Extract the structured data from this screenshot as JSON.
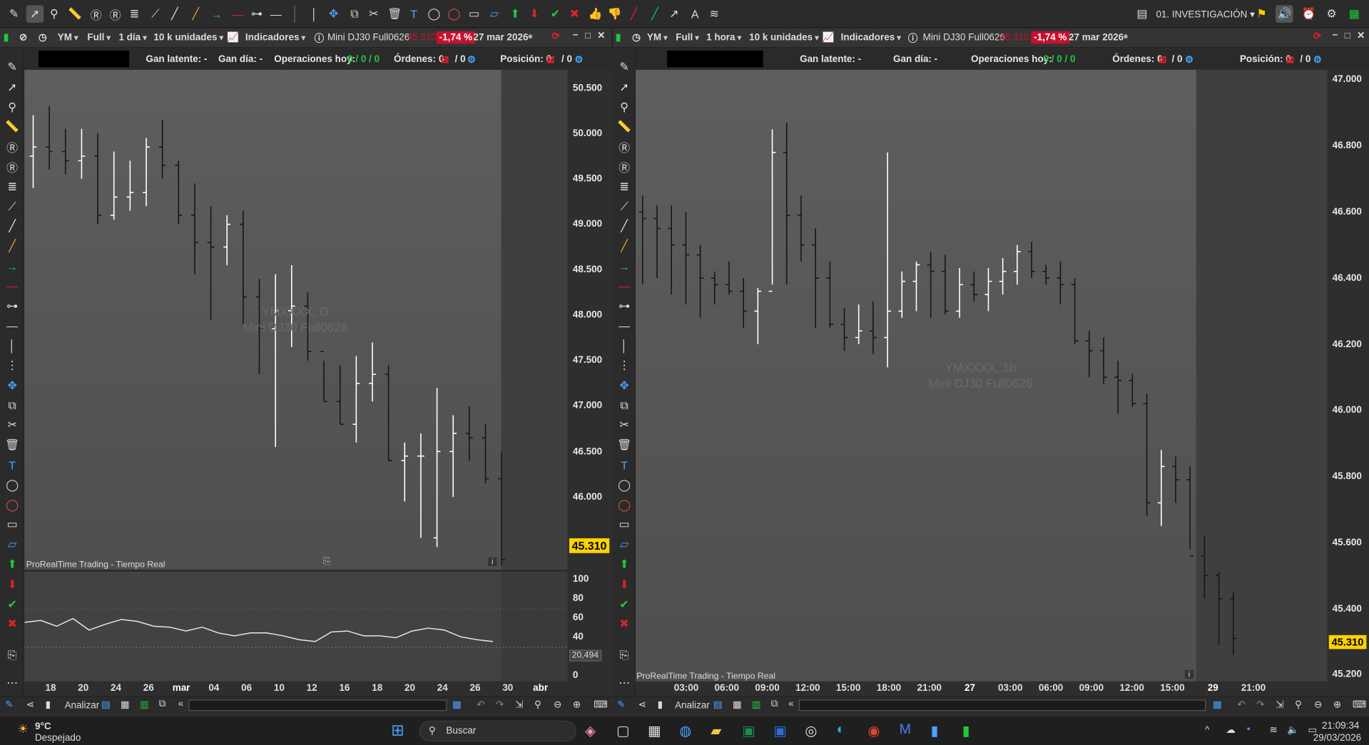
{
  "colors": {
    "up": "#ffffff",
    "down": "#1a1416",
    "neg_badge": "#c8102e",
    "price_tag": "#ffd200",
    "green": "#1ecb3a",
    "red": "#e0202a"
  },
  "toolbar": {
    "icons": [
      "pencil-icon",
      "cursor-icon",
      "zoom-icon",
      "ruler-icon",
      "indicator-r-icon",
      "indicator-r2-icon",
      "fibonacci-icon",
      "segment-icon",
      "line-icon",
      "ray-icon",
      "green-arrow-line-icon",
      "red-line-icon",
      "ray-dots-icon",
      "horizontal-line-icon",
      "vertical-line-icon",
      "move-icon",
      "copy-icon",
      "tools-icon",
      "trash-icon",
      "text-icon",
      "ellipse-icon",
      "red-ellipse-icon",
      "rectangle-icon",
      "parallelogram-icon",
      "up-arrow-icon",
      "down-arrow-icon",
      "check-icon",
      "cross-icon",
      "thumb-up-icon",
      "thumb-down-icon",
      "red-diagonal-icon",
      "green-diagonal-icon",
      "arrow-icon",
      "abc-icon",
      "pattern-icon"
    ],
    "workspace": "01. INVESTIGACIÓN"
  },
  "left_panel": {
    "symbol": "YM",
    "mode": "Full",
    "period": "1 día",
    "units": "10 k unidades",
    "indicators": "Indicadores",
    "instrument": "Mini DJ30 Full0626",
    "price_hidden": "45.310",
    "change": "-1,74 %",
    "date": "27 mar 2026",
    "info": {
      "gan_latente": "Gan latente: -",
      "gan_dia": "Gan día: -",
      "ops_label": "Operaciones hoy:",
      "ops": "0 / 0 / 0",
      "ordenes_label": "Órdenes: 0",
      "ordenes_b": "/ 0",
      "posicion_label": "Posición: 0",
      "posicion_b": "/ 0"
    },
    "watermark": [
      "YMXXXX, D",
      "Mini DJ30 Full0626"
    ],
    "footer": "ProRealTime Trading - Tiempo Real",
    "price_tag": "45.310",
    "rsi_tag": "20,494",
    "yticks": [
      "50.500",
      "50.000",
      "49.500",
      "49.000",
      "48.500",
      "48.000",
      "47.500",
      "47.000",
      "46.500",
      "46.000",
      "45.500"
    ],
    "rsi_ticks": [
      "100",
      "80",
      "60",
      "40",
      "20",
      "0"
    ],
    "xticks": [
      "18",
      "20",
      "24",
      "26",
      "mar",
      "04",
      "06",
      "10",
      "12",
      "16",
      "18",
      "20",
      "24",
      "26",
      "30",
      "abr"
    ]
  },
  "right_panel": {
    "symbol": "YM",
    "mode": "Full",
    "period": "1 hora",
    "units": "10 k unidades",
    "indicators": "Indicadores",
    "instrument": "Mini DJ30 Full0626",
    "price_hidden": "45.310",
    "change": "-1,74 %",
    "date": "27 mar 2026",
    "info": {
      "gan_latente": "Gan latente: -",
      "gan_dia": "Gan día: -",
      "ops_label": "Operaciones hoy:",
      "ops": "0 / 0 / 0",
      "ordenes_label": "Órdenes: 0",
      "ordenes_b": "/ 0",
      "posicion_label": "Posición: 0",
      "posicion_b": "/ 0"
    },
    "watermark": [
      "YMXXXX, 1h",
      "Mini DJ30 Full0626"
    ],
    "footer": "ProRealTime Trading - Tiempo Real",
    "price_tag": "45.310",
    "yticks": [
      "47.000",
      "46.800",
      "46.600",
      "46.400",
      "46.200",
      "46.000",
      "45.800",
      "45.600",
      "45.400",
      "45.200"
    ],
    "xticks": [
      "03:00",
      "06:00",
      "09:00",
      "12:00",
      "15:00",
      "18:00",
      "21:00",
      "27",
      "03:00",
      "06:00",
      "09:00",
      "12:00",
      "15:00",
      "29",
      "21:00"
    ]
  },
  "statusbar": {
    "analyze": "Analizar"
  },
  "taskbar": {
    "temp": "9°C",
    "weather": "Despejado",
    "search": "Buscar",
    "time": "21:09:34",
    "date": "29/03/2026"
  },
  "chart_data": [
    {
      "type": "ohlc",
      "title": "YMXXXX, D",
      "ylim": [
        45200,
        50700
      ],
      "bars": [
        [
          49750,
          50200,
          49400,
          49850
        ],
        [
          49850,
          50300,
          49600,
          49800
        ],
        [
          49800,
          50050,
          49550,
          49700
        ],
        [
          49700,
          50050,
          49500,
          49750
        ],
        [
          49750,
          50000,
          49000,
          49100
        ],
        [
          49100,
          49800,
          49050,
          49300
        ],
        [
          49300,
          49700,
          49150,
          49350
        ],
        [
          49350,
          49950,
          49200,
          49850
        ],
        [
          49850,
          50150,
          49500,
          49650
        ],
        [
          49650,
          49700,
          49000,
          49100
        ],
        [
          49100,
          49450,
          48450,
          48800
        ],
        [
          48800,
          49200,
          47950,
          48750
        ],
        [
          48750,
          49100,
          48550,
          49000
        ],
        [
          49000,
          49150,
          47900,
          48200
        ],
        [
          48200,
          48400,
          47350,
          47850
        ],
        [
          47850,
          48450,
          46550,
          48050
        ],
        [
          48050,
          48550,
          47650,
          48100
        ],
        [
          48100,
          48250,
          47500,
          47600
        ],
        [
          47600,
          47500,
          47050,
          47050
        ],
        [
          47050,
          47450,
          46800,
          46800
        ],
        [
          46800,
          47550,
          46600,
          47250
        ],
        [
          47250,
          47700,
          47050,
          47350
        ],
        [
          47350,
          47450,
          46400,
          46400
        ],
        [
          46400,
          46600,
          45950,
          46450
        ],
        [
          46450,
          46700,
          45550,
          46450
        ],
        [
          45550,
          47200,
          45450,
          46500
        ],
        [
          46500,
          46900,
          46000,
          46700
        ],
        [
          46700,
          47000,
          46400,
          46650
        ],
        [
          46650,
          46800,
          46150,
          46200
        ],
        [
          46200,
          46500,
          45250,
          45310
        ]
      ],
      "rsi": [
        56,
        58,
        52,
        60,
        48,
        54,
        59,
        57,
        52,
        51,
        47,
        51,
        45,
        42,
        45,
        45,
        42,
        38,
        36,
        46,
        47,
        42,
        42,
        40,
        47,
        50,
        48,
        41,
        38,
        36
      ]
    },
    {
      "type": "ohlc",
      "title": "YMXXXX, 1h",
      "ylim": [
        45180,
        47030
      ],
      "bars": [
        [
          46600,
          46650,
          46380,
          46580
        ],
        [
          46580,
          46620,
          46400,
          46550
        ],
        [
          46550,
          46620,
          46350,
          46500
        ],
        [
          46500,
          46600,
          46320,
          46470
        ],
        [
          46470,
          46500,
          46280,
          46400
        ],
        [
          46400,
          46420,
          46320,
          46380
        ],
        [
          46380,
          46450,
          46350,
          46360
        ],
        [
          46360,
          46400,
          46250,
          46300
        ],
        [
          46300,
          46370,
          46200,
          46360
        ],
        [
          46360,
          46850,
          46380,
          46780
        ],
        [
          46780,
          46870,
          46380,
          46590
        ],
        [
          46590,
          46650,
          46450,
          46500
        ],
        [
          46500,
          46550,
          46250,
          46400
        ],
        [
          46400,
          46450,
          46250,
          46260
        ],
        [
          46260,
          46310,
          46180,
          46220
        ],
        [
          46220,
          46320,
          46200,
          46240
        ],
        [
          46240,
          46330,
          46170,
          46220
        ],
        [
          46220,
          46780,
          46130,
          46300
        ],
        [
          46300,
          46420,
          46280,
          46390
        ],
        [
          46390,
          46450,
          46300,
          46440
        ],
        [
          46440,
          46480,
          46280,
          46420
        ],
        [
          46420,
          46470,
          46290,
          46300
        ],
        [
          46300,
          46430,
          46280,
          46380
        ],
        [
          46380,
          46420,
          46330,
          46350
        ],
        [
          46350,
          46430,
          46300,
          46390
        ],
        [
          46390,
          46460,
          46350,
          46420
        ],
        [
          46420,
          46500,
          46380,
          46480
        ],
        [
          46480,
          46510,
          46400,
          46420
        ],
        [
          46420,
          46440,
          46380,
          46400
        ],
        [
          46400,
          46450,
          46320,
          46380
        ],
        [
          46380,
          46400,
          46200,
          46210
        ],
        [
          46210,
          46240,
          46100,
          46180
        ],
        [
          46180,
          46220,
          46080,
          46100
        ],
        [
          46100,
          46150,
          45990,
          46090
        ],
        [
          46090,
          46110,
          46010,
          46020
        ],
        [
          46020,
          46050,
          45680,
          45720
        ],
        [
          45720,
          45880,
          45650,
          45830
        ],
        [
          45830,
          45860,
          45720,
          45790
        ],
        [
          45790,
          45830,
          45580,
          45560
        ],
        [
          45560,
          45620,
          45430,
          45500
        ],
        [
          45500,
          45510,
          45290,
          45430
        ],
        [
          45430,
          45450,
          45260,
          45310
        ]
      ]
    }
  ]
}
